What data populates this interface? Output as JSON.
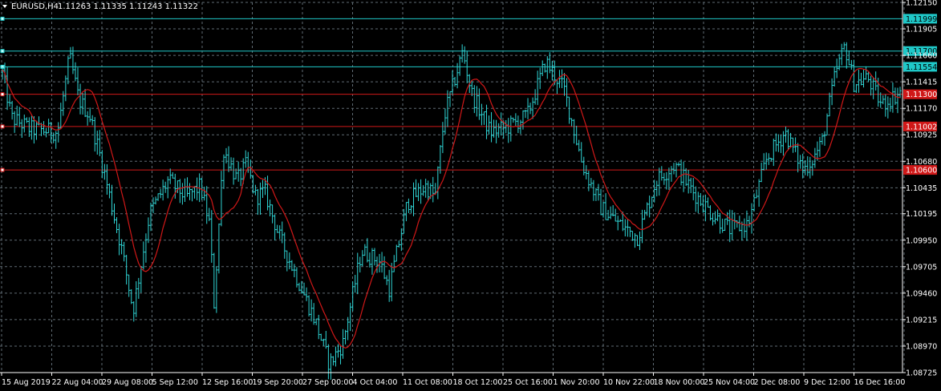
{
  "header": {
    "symbol": "EURUSD,H4",
    "ohlc": "1.11263 1.11335 1.11243 1.11322"
  },
  "colors": {
    "background": "#000000",
    "grid": "#5f6b73",
    "candle": "#2fd6d6",
    "moving_average": "#d01818",
    "level_cyan": "#1fc8c8",
    "level_red": "#d01818",
    "text": "#ffffff"
  },
  "chart_data": {
    "type": "line",
    "series_kind": "ohlc_bars_with_moving_average",
    "price_ticks": [
      "1.12150",
      "1.11905",
      "1.11660",
      "1.11415",
      "1.11170",
      "1.10925",
      "1.10680",
      "1.10435",
      "1.10195",
      "1.09950",
      "1.09705",
      "1.09460",
      "1.09215",
      "1.08970",
      "1.08725"
    ],
    "time_ticks": [
      "15 Aug 2019",
      "22 Aug 04:00",
      "29 Aug 08:00",
      "5 Sep 12:00",
      "12 Sep 16:00",
      "19 Sep 20:00",
      "27 Sep 00:00",
      "4 Oct 04:00",
      "11 Oct 08:00",
      "18 Oct 12:00",
      "25 Oct 16:00",
      "1 Nov 20:00",
      "10 Nov 22:00",
      "18 Nov 00:00",
      "25 Nov 04:00",
      "2 Dec 08:00",
      "9 Dec 12:00",
      "16 Dec 16:00"
    ],
    "ylim": [
      1.08725,
      1.1215
    ],
    "levels": [
      {
        "price": "1.11999",
        "value": 1.11999,
        "color": "cyan"
      },
      {
        "price": "1.11700",
        "value": 1.117,
        "color": "cyan"
      },
      {
        "price": "1.11554",
        "value": 1.11554,
        "color": "cyan"
      },
      {
        "price": "1.11300",
        "value": 1.113,
        "color": "red"
      },
      {
        "price": "1.11002",
        "value": 1.11002,
        "color": "red"
      },
      {
        "price": "1.10600",
        "value": 1.106,
        "color": "red"
      }
    ],
    "price_path": [
      [
        0,
        1.115
      ],
      [
        0.01,
        1.1108
      ],
      [
        0.03,
        1.1098
      ],
      [
        0.06,
        1.1095
      ],
      [
        0.073,
        1.1165
      ],
      [
        0.083,
        1.1125
      ],
      [
        0.095,
        1.111
      ],
      [
        0.11,
        1.106
      ],
      [
        0.13,
        1.0985
      ],
      [
        0.142,
        1.093
      ],
      [
        0.16,
        1.102
      ],
      [
        0.18,
        1.105
      ],
      [
        0.2,
        1.1035
      ],
      [
        0.215,
        1.1045
      ],
      [
        0.225,
        1.101
      ],
      [
        0.23,
        1.0935
      ],
      [
        0.24,
        1.108
      ],
      [
        0.255,
        1.105
      ],
      [
        0.265,
        1.1065
      ],
      [
        0.275,
        1.1035
      ],
      [
        0.285,
        1.104
      ],
      [
        0.3,
        1.1
      ],
      [
        0.32,
        1.096
      ],
      [
        0.34,
        1.092
      ],
      [
        0.355,
        1.088
      ],
      [
        0.37,
        1.09
      ],
      [
        0.39,
        1.0985
      ],
      [
        0.41,
        1.0975
      ],
      [
        0.42,
        1.095
      ],
      [
        0.44,
        1.103
      ],
      [
        0.46,
        1.1045
      ],
      [
        0.47,
        1.1035
      ],
      [
        0.48,
        1.111
      ],
      [
        0.49,
        1.114
      ],
      [
        0.5,
        1.117
      ],
      [
        0.51,
        1.113
      ],
      [
        0.53,
        1.1095
      ],
      [
        0.55,
        1.11
      ],
      [
        0.57,
        1.111
      ],
      [
        0.59,
        1.116
      ],
      [
        0.61,
        1.1135
      ],
      [
        0.63,
        1.1065
      ],
      [
        0.65,
        1.1025
      ],
      [
        0.67,
        1.101
      ],
      [
        0.69,
        1.0998
      ],
      [
        0.71,
        1.105
      ],
      [
        0.73,
        1.1065
      ],
      [
        0.75,
        1.104
      ],
      [
        0.77,
        1.102
      ],
      [
        0.79,
        1.1005
      ],
      [
        0.81,
        1.101
      ],
      [
        0.83,
        1.107
      ],
      [
        0.85,
        1.1095
      ],
      [
        0.87,
        1.106
      ],
      [
        0.88,
        1.107
      ],
      [
        0.89,
        1.1085
      ],
      [
        0.905,
        1.115
      ],
      [
        0.915,
        1.1175
      ],
      [
        0.925,
        1.114
      ],
      [
        0.94,
        1.1145
      ],
      [
        0.955,
        1.112
      ],
      [
        0.975,
        1.1132
      ]
    ]
  }
}
